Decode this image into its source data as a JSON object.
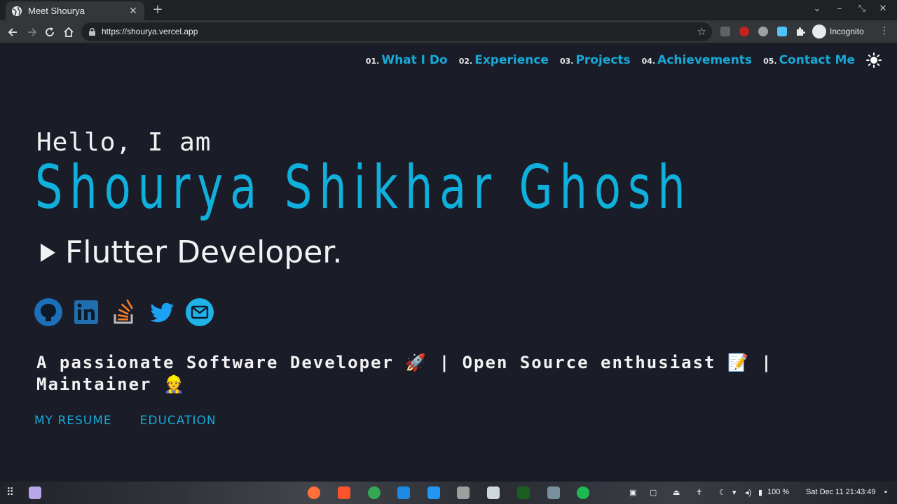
{
  "browser": {
    "tab_title": "Meet Shourya",
    "url": "https://shourya.vercel.app",
    "profile_label": "Incognito"
  },
  "nav": [
    {
      "num": "01.",
      "label": "What I Do"
    },
    {
      "num": "02.",
      "label": "Experience"
    },
    {
      "num": "03.",
      "label": "Projects"
    },
    {
      "num": "04.",
      "label": "Achievements"
    },
    {
      "num": "05.",
      "label": "Contact Me"
    }
  ],
  "hero": {
    "greeting": "Hello, I am",
    "name": "Shourya Shikhar Ghosh",
    "role": "Flutter Developer."
  },
  "socials": [
    "github-icon",
    "linkedin-icon",
    "stackoverflow-icon",
    "twitter-icon",
    "email-icon"
  ],
  "tagline": "A passionate Software Developer 🚀 | Open Source enthusiast 📝 | Maintainer 👷",
  "links": {
    "resume": "MY RESUME",
    "education": "EDUCATION"
  },
  "colors": {
    "accent": "#17a9d6",
    "page_bg": "#1a1c28"
  },
  "taskbar": {
    "battery": "100 %",
    "clock": "Sat Dec 11  21:43:49"
  }
}
